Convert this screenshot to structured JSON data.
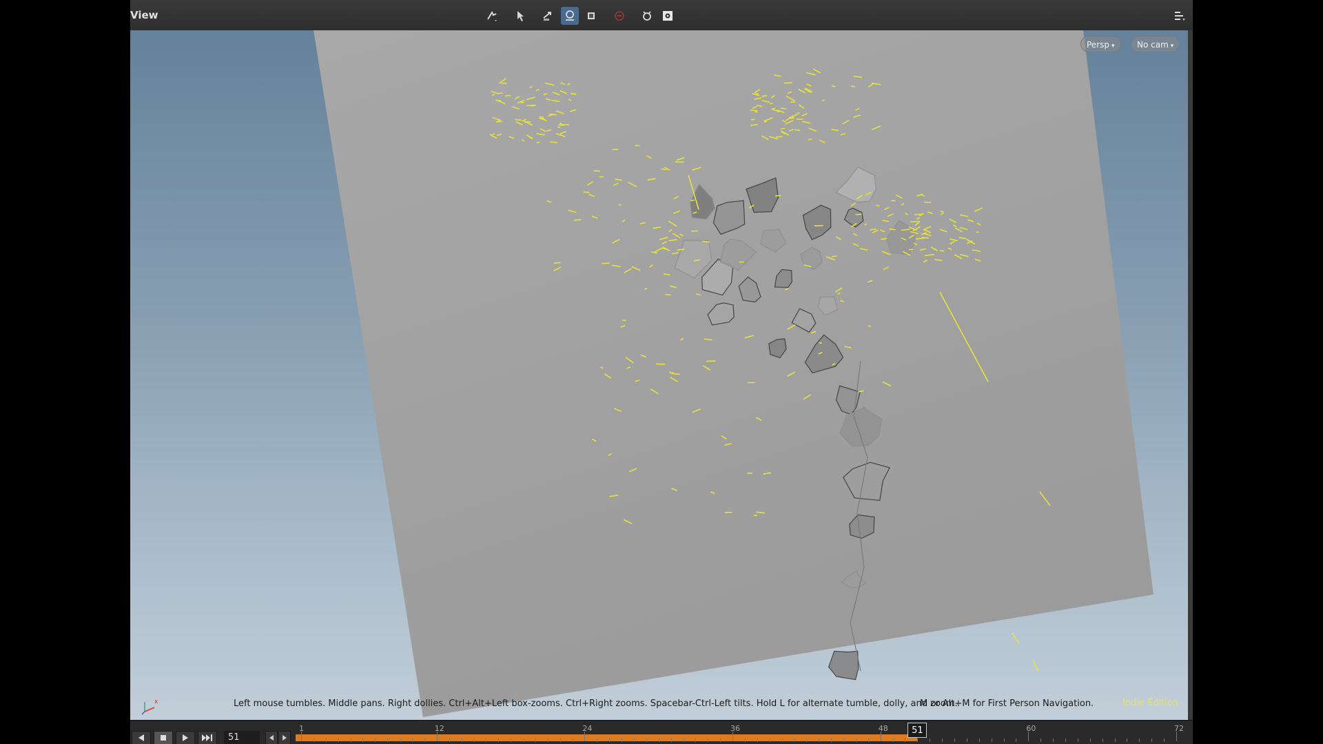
{
  "panel": {
    "title": "View"
  },
  "toolbar": {
    "icons": [
      "handle-tool-icon",
      "select-tool-icon",
      "transform-tool-icon",
      "snap-toggle-icon",
      "display-mode-icon",
      "stop-icon",
      "render-icon",
      "settings-icon"
    ],
    "active_color": "#4a6a8e"
  },
  "viewport": {
    "camera_mode": "Persp",
    "camera": "No cam",
    "hint_text": "Left mouse tumbles. Middle pans. Right dollies. Ctrl+Alt+Left box-zooms. Ctrl+Right zooms. Spacebar-Ctrl-Left tilts. Hold L for alternate tumble, dolly, and zoom.",
    "hint_text_2": "M or Alt+M for First Person Navigation.",
    "edition": "Indie Edition",
    "particle_color": "#e8e23a"
  },
  "timeline": {
    "current_frame": "51",
    "ticks": [
      "1",
      "12",
      "24",
      "36",
      "48",
      "60",
      "72"
    ],
    "start": 1,
    "end": 72,
    "frame_value": 51,
    "track_color": "#e07a1e"
  }
}
